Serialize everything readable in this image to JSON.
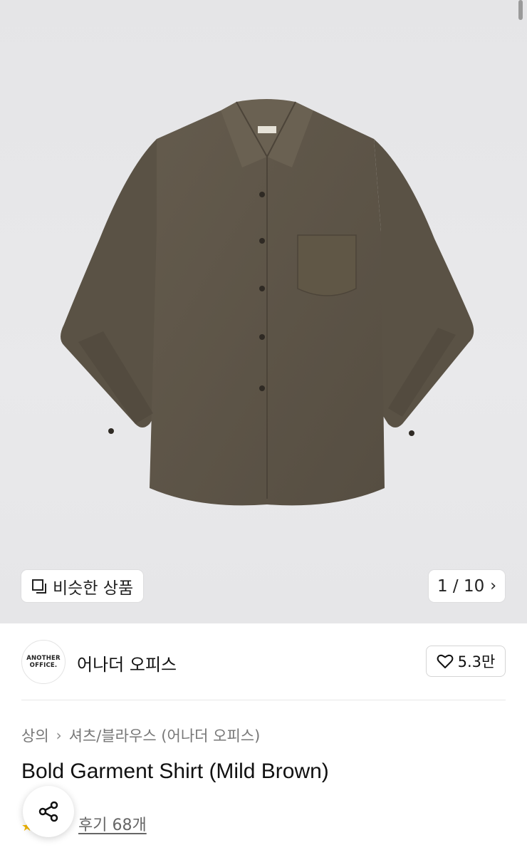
{
  "gallery": {
    "similar_label": "비슷한 상품",
    "counter": "1 / 10",
    "image_alt": "shirt-photo",
    "colors": {
      "shirt": "#5e5547",
      "shirt_dark": "#4a4338",
      "background": "#e7e7e9"
    }
  },
  "brand": {
    "logo_line1": "ANOTHER",
    "logo_line2": "OFFICE.",
    "name": "어나더 오피스",
    "likes": "5.3만"
  },
  "product": {
    "breadcrumb": [
      "상의",
      "셔츠/블라우스 (어나더 오피스)"
    ],
    "title": "Bold Garment Shirt (Mild Brown)",
    "reviews": "후기 68개"
  }
}
